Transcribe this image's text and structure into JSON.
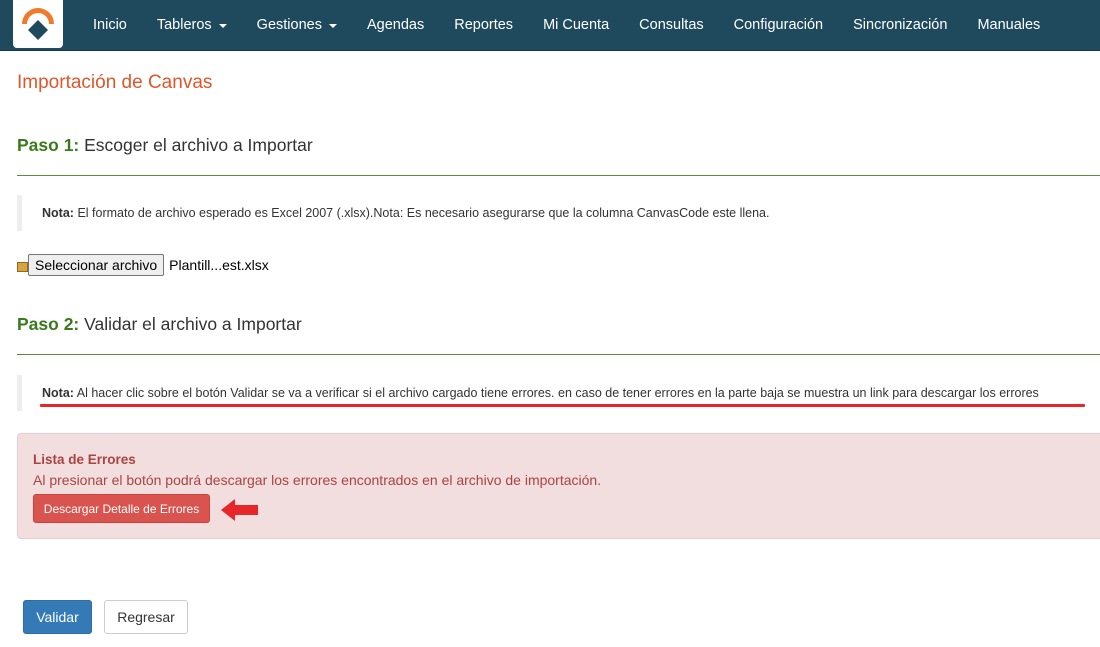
{
  "navbar": {
    "logo": "app-logo",
    "items": [
      {
        "label": "Inicio",
        "dropdown": false
      },
      {
        "label": "Tableros",
        "dropdown": true
      },
      {
        "label": "Gestiones",
        "dropdown": true
      },
      {
        "label": "Agendas",
        "dropdown": false
      },
      {
        "label": "Reportes",
        "dropdown": false
      },
      {
        "label": "Mi Cuenta",
        "dropdown": false
      },
      {
        "label": "Consultas",
        "dropdown": false
      },
      {
        "label": "Configuración",
        "dropdown": false
      },
      {
        "label": "Sincronización",
        "dropdown": false
      },
      {
        "label": "Manuales",
        "dropdown": false
      }
    ]
  },
  "page": {
    "title": "Importación de Canvas"
  },
  "step1": {
    "label": "Paso 1:",
    "text": "Escoger el archivo a Importar",
    "note_label": "Nota:",
    "note_text": "El formato de archivo esperado es Excel 2007 (.xlsx).Nota: Es necesario asegurarse que la columna CanvasCode este llena.",
    "file_button": "Seleccionar archivo",
    "file_name": "Plantill...est.xlsx"
  },
  "step2": {
    "label": "Paso 2:",
    "text": "Validar el archivo a Importar",
    "note_label": "Nota:",
    "note_text": "Al hacer clic sobre el botón Validar se va a verificar si el archivo cargado tiene errores. en caso de tener errores en la parte baja se muestra un link para descargar los errores"
  },
  "errors": {
    "title": "Lista de Errores",
    "description": "Al presionar el botón podrá descargar los errores encontrados en el archivo de importación.",
    "download_button": "Descargar Detalle de Errores"
  },
  "actions": {
    "validate": "Validar",
    "back": "Regresar"
  },
  "colors": {
    "navbar": "#1f4a5e",
    "title": "#e0562b",
    "step_label": "#3a7a1c",
    "rule": "#5b8b3c",
    "error_bg": "#f2dede",
    "error_text": "#a94442",
    "danger": "#d9534f",
    "primary": "#337ab7",
    "annotation": "#e8262a"
  }
}
